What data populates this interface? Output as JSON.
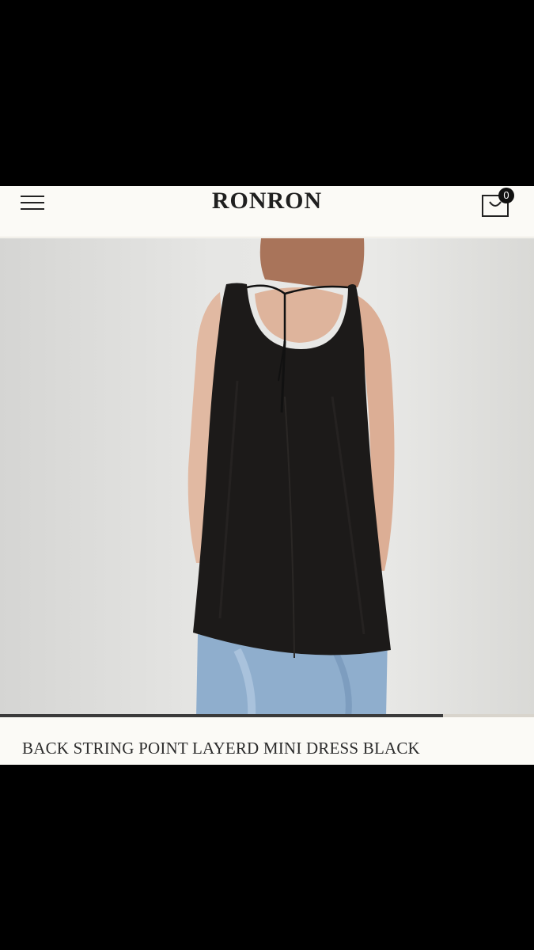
{
  "header": {
    "logo": "RONRON",
    "cart_count": "0",
    "menu_icon": "hamburger-menu-icon",
    "cart_icon": "shopping-bag-icon"
  },
  "product": {
    "title": "BACK STRING POINT LAYERD MINI DRESS BLACK",
    "image_description_icon": "product-photo",
    "gallery_progress": 0.83
  },
  "colors": {
    "background": "#fbfaf6",
    "text": "#1f1f1f",
    "dress": "#1c1a19",
    "denim": "#8faecd"
  }
}
